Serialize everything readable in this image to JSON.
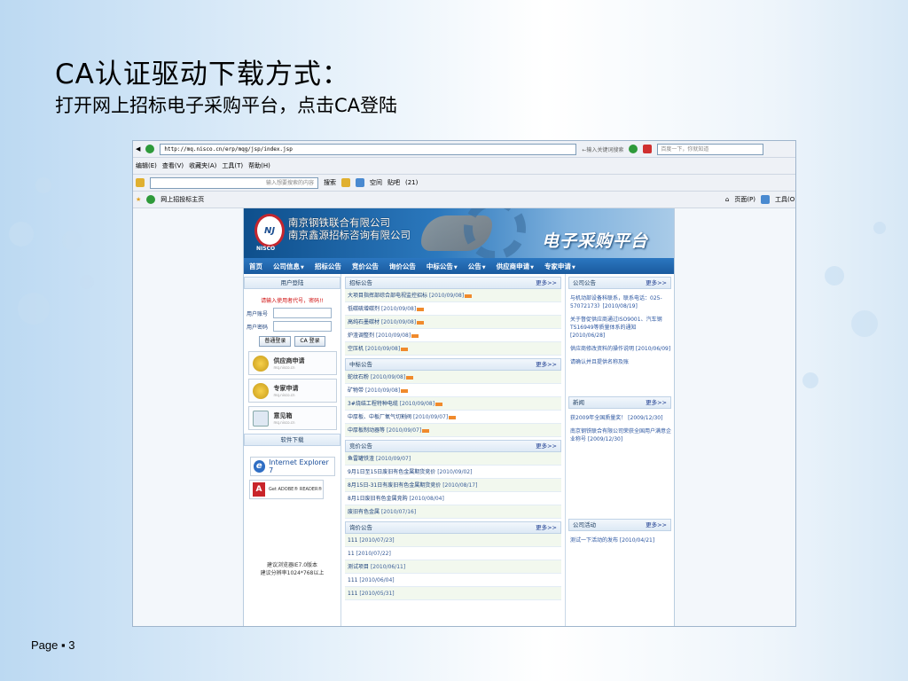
{
  "slide": {
    "title": "CA认证驱动下载方式：",
    "subtitle": "打开网上招标电子采购平台，点击CA登陆",
    "page_number": "Page ▪ 3"
  },
  "browser": {
    "address": "http://mq.nisco.cn/erp/mqg/jsp/index.jsp",
    "address_search_hint": "←输入关键词搜索",
    "search_box": "百度一下，你就知道",
    "menu": [
      "编辑(E)",
      "查看(V)",
      "收藏夹(A)",
      "工具(T)",
      "帮助(H)"
    ],
    "toolbar_search_placeholder": "输入想要搜索的内容",
    "toolbar_search_btn": "搜索",
    "toolbar_items": [
      "搜索",
      "空间",
      "贴吧",
      "(21)"
    ],
    "tab_title": "网上招投标主页",
    "page_tools": [
      "页面(P)",
      "工具(O)"
    ]
  },
  "site": {
    "company_lines": [
      "南京钢铁联合有限公司",
      "南京鑫源招标咨询有限公司"
    ],
    "logo_text": "NISCO",
    "platform_title": "电子采购平台",
    "nav": [
      "首页",
      "公司信息",
      "招标公告",
      "竞价公告",
      "询价公告",
      "中标公告",
      "公告",
      "供应商申请",
      "专家申请"
    ],
    "login": {
      "header": "用户登陆",
      "warning": "请输入使用者代号，密码!!",
      "username_label": "用户账号",
      "password_label": "用户密码",
      "normal_login": "普通登录",
      "ca_login": "CA 登录"
    },
    "cards": [
      {
        "title": "供应商申请",
        "sub": "mq.nisco.cn"
      },
      {
        "title": "专家申请",
        "sub": "mq.nisco.cn"
      },
      {
        "title": "意见箱",
        "sub": "mq.nisco.cn"
      }
    ],
    "software_header": "软件下载",
    "ie_label": "Internet Explorer 7",
    "adobe_label": "Get ADOBE® READER®",
    "recommend": [
      "建议浏览器IE7.0版本",
      "建议分辨率1024*768以上"
    ],
    "more": "更多>>",
    "tender": {
      "header": "招标公告",
      "rows": [
        {
          "t": "大项目指挥部综合部电视监控招标",
          "d": "[2010/09/08]"
        },
        {
          "t": "低碳硫增碳剂",
          "d": "[2010/09/08]"
        },
        {
          "t": "高纯石墨碳材",
          "d": "[2010/09/08]"
        },
        {
          "t": "炉渣调整剂",
          "d": "[2010/09/08]"
        },
        {
          "t": "空压机",
          "d": "[2010/09/08]"
        }
      ]
    },
    "award": {
      "header": "中标公告",
      "rows": [
        {
          "t": "蛇纹石粉",
          "d": "[2010/09/08]"
        },
        {
          "t": "矿物带",
          "d": "[2010/09/08]"
        },
        {
          "t": "3#烧结工程特种电缆",
          "d": "[2010/09/08]"
        },
        {
          "t": "中厚板、中板厂氧气切割阀",
          "d": "[2010/09/07]"
        },
        {
          "t": "中厚板制动器等",
          "d": "[2010/09/07]"
        }
      ]
    },
    "bidding": {
      "header": "竞价公告",
      "rows": [
        {
          "t": "鱼雷罐铁渣",
          "d": "[2010/09/07]"
        },
        {
          "t": "9月1日至15日废旧有色金属期货竞价",
          "d": "[2010/09/02]"
        },
        {
          "t": "8月15日-31日有废旧有色金属期货竞价",
          "d": "[2010/08/17]"
        },
        {
          "t": "8月1日废旧有色金属竞购",
          "d": "[2010/08/04]"
        },
        {
          "t": "废旧有色金属",
          "d": "[2010/07/16]"
        }
      ]
    },
    "inquiry": {
      "header": "询价公告",
      "rows": [
        {
          "t": "111",
          "d": "[2010/07/23]"
        },
        {
          "t": "11",
          "d": "[2010/07/22]"
        },
        {
          "t": "测试项目",
          "d": "[2010/06/11]"
        },
        {
          "t": "111",
          "d": "[2010/06/04]"
        },
        {
          "t": "111",
          "d": "[2010/05/31]"
        }
      ]
    },
    "company_notice": {
      "header": "公司公告",
      "items": [
        "与机动部设备科联系，联系电话：025-57072173》[2010/08/19]",
        "关于督促供应商通过ISO9001、汽车钢TS16949等质量体系的通知 [2010/06/28]",
        "供应商修改资料的操作说明 [2010/06/09]",
        "请确认并且提供名称及账"
      ]
    },
    "news": {
      "header": "新闻",
      "items": [
        "获2009年全国质量奖！ [2009/12/30]",
        "南京钢铁联合有限公司荣获全国用户满意企业称号 [2009/12/30]"
      ]
    },
    "activity": {
      "header": "公司活动",
      "items": [
        "测试一下活动的发布 [2010/04/21]"
      ]
    }
  }
}
